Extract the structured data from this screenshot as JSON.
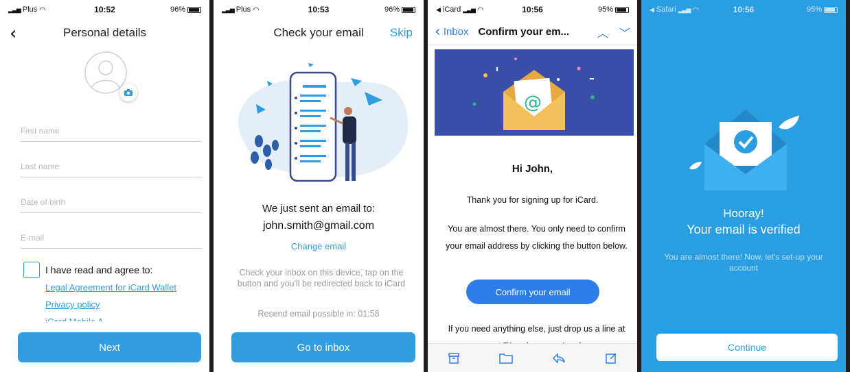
{
  "screens": {
    "personal": {
      "status": {
        "carrier": "Plus",
        "time": "10:52",
        "battery": "96%"
      },
      "title": "Personal details",
      "fields": {
        "first_name": "First name",
        "last_name": "Last name",
        "dob": "Date of birth",
        "email": "E-mail"
      },
      "agree_label": "I have read and agree to:",
      "links": {
        "legal": "Legal Agreement for iCard Wallet",
        "privacy": "Privacy policy",
        "partial": "iCard Mobile A"
      },
      "next_label": "Next"
    },
    "check": {
      "status": {
        "carrier": "Plus",
        "time": "10:53",
        "battery": "96%"
      },
      "title": "Check your email",
      "skip": "Skip",
      "sent_text": "We just sent an email to:",
      "email": "john.smith@gmail.com",
      "change_email": "Change email",
      "instructions": "Check your inbox on this device, tap on the button and you'll be redirected back to iCard",
      "resend": "Resend email possible in: 01:58",
      "go_inbox": "Go to inbox"
    },
    "mail": {
      "status": {
        "carrier": "iCard",
        "time": "10:56",
        "battery": "95%"
      },
      "back": "Inbox",
      "subject": "Confirm your em...",
      "greeting": "Hi John,",
      "thanks": "Thank you for signing up for iCard.",
      "almost": "You are almost there. You only need to confirm your email address by clicking the button below.",
      "confirm_button": "Confirm your email",
      "footer_text": "If you need anything else, just drop us a line at support@icard.com, we're always"
    },
    "verified": {
      "status": {
        "carrier": "Safari",
        "time": "10:56",
        "battery": "95%"
      },
      "hooray": "Hooray!",
      "verified": "Your email is verified",
      "subtext": "You are almost there! Now, let's set-up your account",
      "continue": "Continue"
    }
  },
  "colors": {
    "accent": "#2f9de0",
    "mail_blue": "#2f7de8",
    "verified_bg": "#2a9ee0",
    "banner_bg": "#3a4fa8"
  }
}
